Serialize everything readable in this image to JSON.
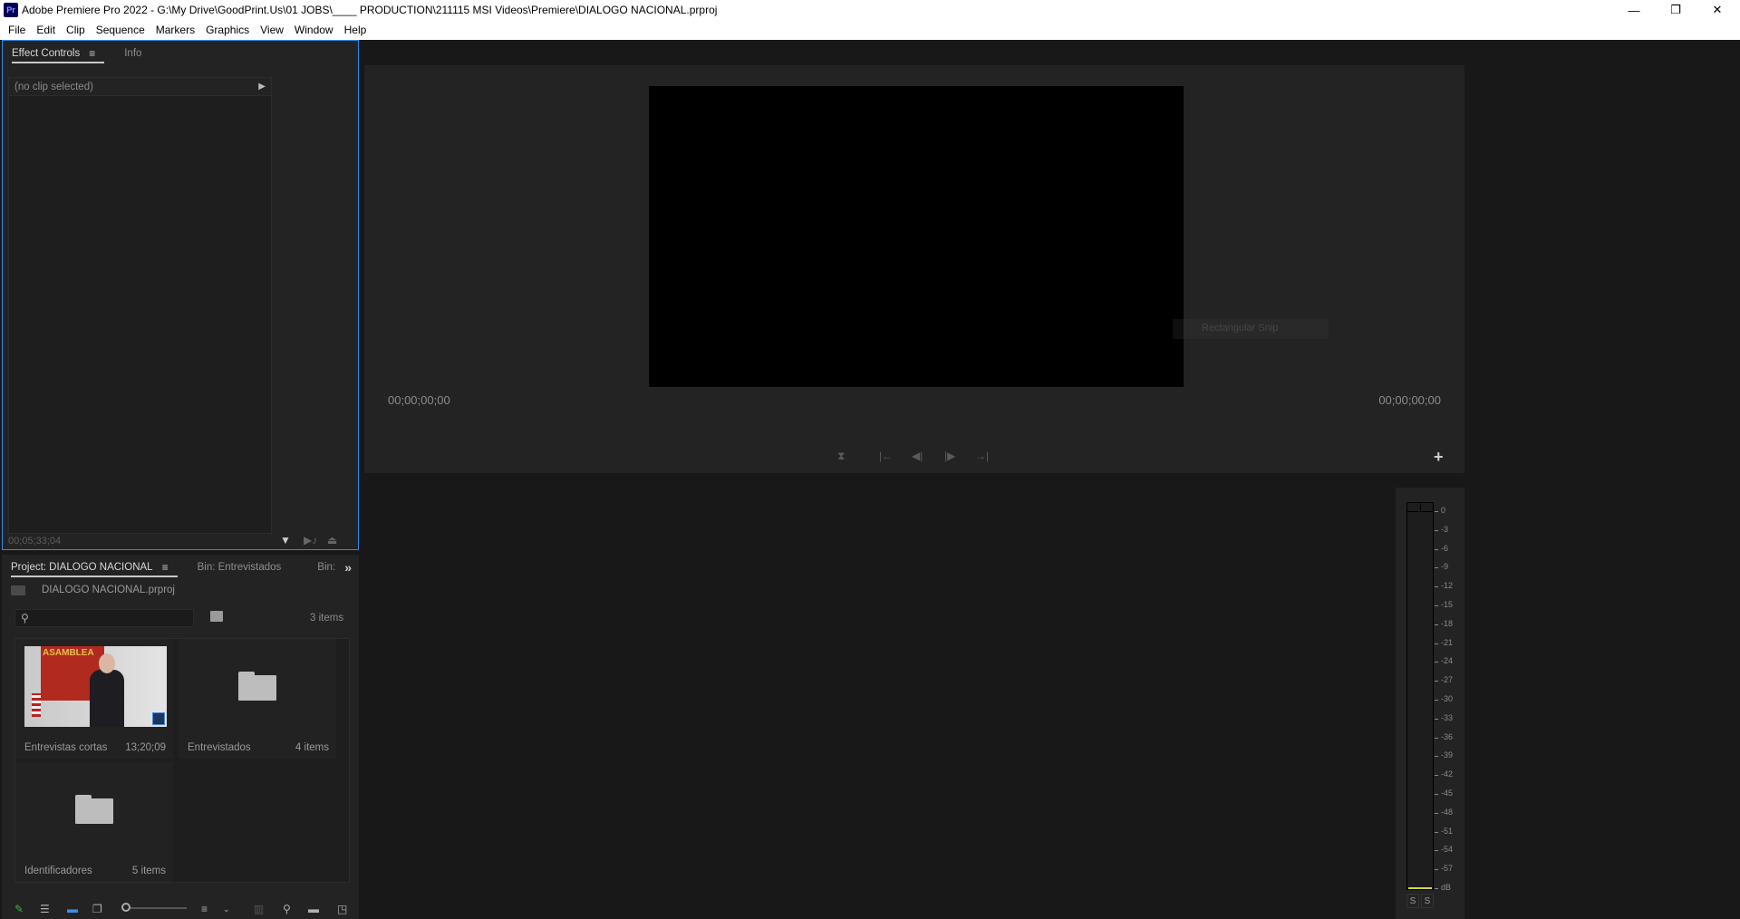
{
  "window": {
    "app_icon": "Pr",
    "title": "Adobe Premiere Pro 2022 - G:\\My Drive\\GoodPrint.Us\\01 JOBS\\____ PRODUCTION\\211115 MSI Videos\\Premiere\\DIALOGO NACIONAL.prproj",
    "minimize": "—",
    "restore": "❐",
    "close": "✕"
  },
  "menu": [
    "File",
    "Edit",
    "Clip",
    "Sequence",
    "Markers",
    "Graphics",
    "View",
    "Window",
    "Help"
  ],
  "effect_controls": {
    "tabs": [
      {
        "label": "Effect Controls",
        "active": true
      },
      {
        "label": "Info",
        "active": false
      }
    ],
    "menu_icon": "≡",
    "header": "(no clip selected)",
    "expand_icon": "▶",
    "timecode": "00;05;33;04",
    "icons": [
      "filter-icon",
      "play-audio-icon",
      "export-icon"
    ]
  },
  "project": {
    "tabs": [
      {
        "label": "Project: DIALOGO NACIONAL",
        "active": true
      },
      {
        "label": "Bin: Entrevistados",
        "active": false
      },
      {
        "label": "Bin:",
        "active": false
      }
    ],
    "overflow_icon": "»",
    "path": "DIALOGO NACIONAL.prproj",
    "search_placeholder": "",
    "items_count": "3 items",
    "items": [
      {
        "name": "Entrevistas cortas",
        "meta": "13;20;09",
        "type": "sequence"
      },
      {
        "name": "Entrevistados",
        "meta": "4 items",
        "type": "bin"
      },
      {
        "name": "Identificadores",
        "meta": "5 items",
        "type": "bin"
      }
    ],
    "thumb_text": "ASAMBLEA",
    "zoom_level": 0
  },
  "monitor": {
    "timecode_left": "00;00;00;00",
    "timecode_right": "00;00;00;00",
    "tooltip": "Rectangular Snip",
    "transport": [
      "⧗",
      "|←",
      "◀|",
      "|▶",
      "→|"
    ],
    "add_button": "+"
  },
  "audio_meter": {
    "scale": [
      "0",
      "-3",
      "-6",
      "-9",
      "-12",
      "-15",
      "-18",
      "-21",
      "-24",
      "-27",
      "-30",
      "-33",
      "-36",
      "-39",
      "-42",
      "-45",
      "-48",
      "-51",
      "-54",
      "-57",
      "dB"
    ],
    "solo_left": "S",
    "solo_right": "S"
  },
  "colors": {
    "accent": "#2d8ceb",
    "panel_bg": "#232323",
    "app_bg": "#181818",
    "meter_level": "#d8d83a"
  }
}
